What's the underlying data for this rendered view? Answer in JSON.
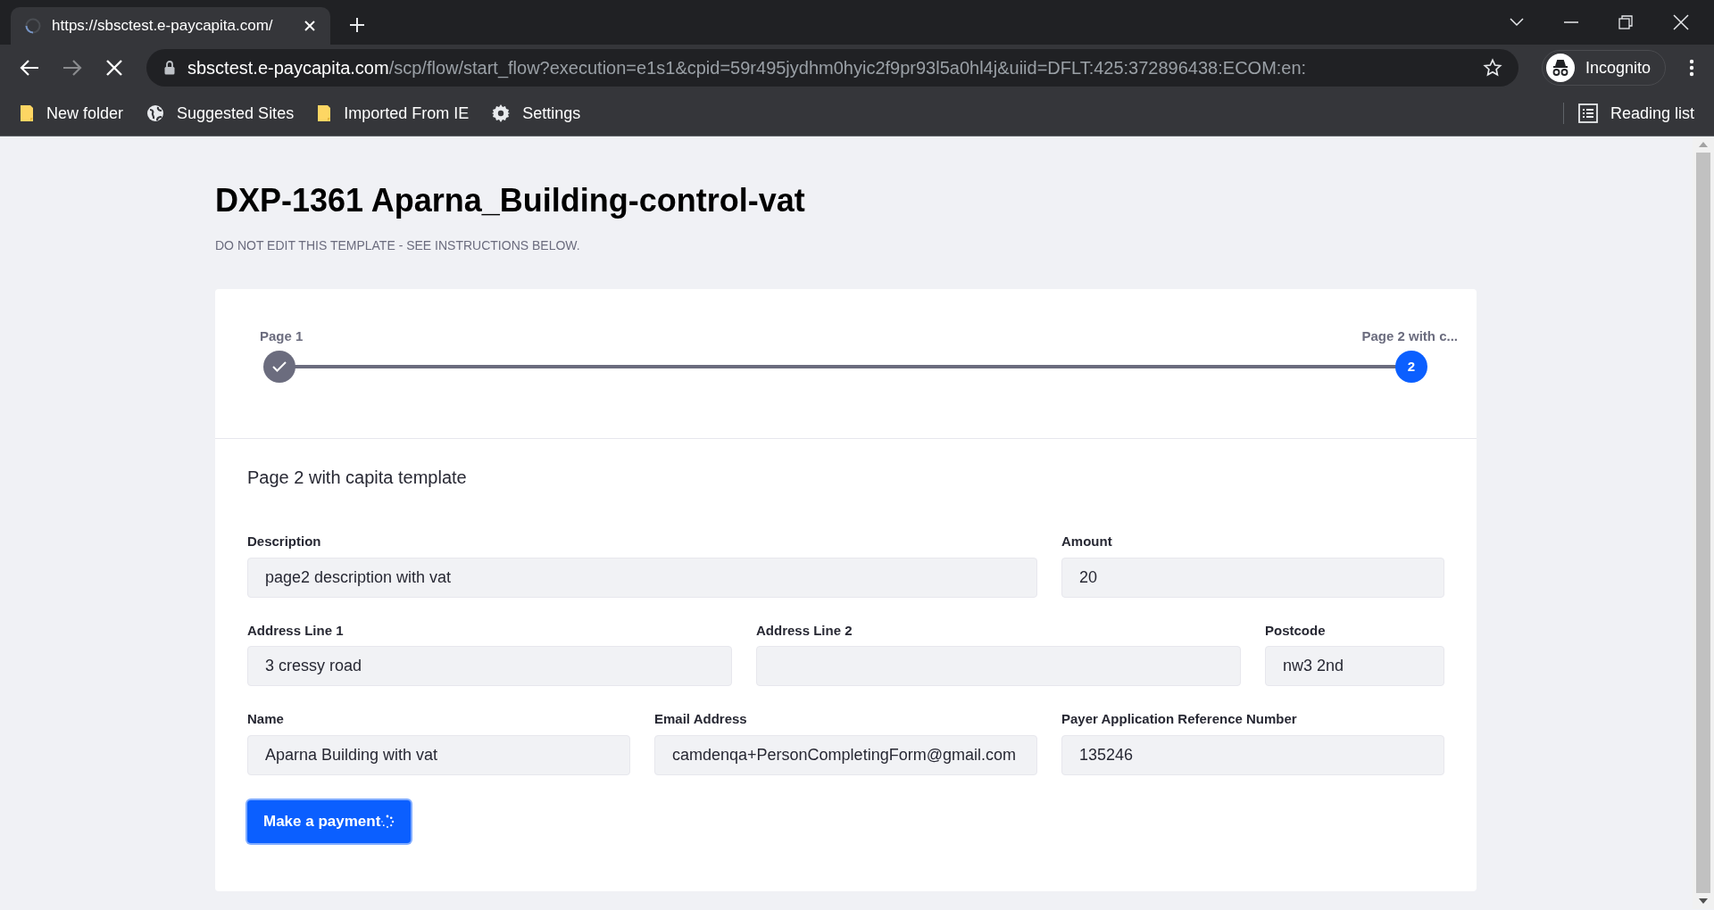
{
  "browser": {
    "tab": {
      "title": "https://sbsctest.e-paycapita.com/",
      "loading": true
    },
    "address": {
      "host": "sbsctest.e-paycapita.com",
      "path": "/scp/flow/start_flow?execution=e1s1&cpid=59r495jydhm0hyic2f9pr93l5a0hl4j&uiid=DFLT:425:372896438:ECOM:en:"
    },
    "profile": "Incognito",
    "bookmarks": [
      {
        "kind": "folder",
        "label": "New folder"
      },
      {
        "kind": "globe",
        "label": "Suggested Sites"
      },
      {
        "kind": "folder",
        "label": "Imported From IE"
      },
      {
        "kind": "gear",
        "label": "Settings"
      }
    ],
    "reading_list": "Reading list"
  },
  "page": {
    "title": "DXP-1361 Aparna_Building-control-vat",
    "subtitle": "DO NOT EDIT THIS TEMPLATE - SEE INSTRUCTIONS BELOW.",
    "steps": [
      {
        "label": "Page 1",
        "completed": true,
        "selected": false
      },
      {
        "label": "Page 2 with c...",
        "number": "2",
        "completed": false,
        "selected": true
      }
    ],
    "section_title": "Page 2 with capita template",
    "field_rows": [
      [
        {
          "label": "Description",
          "value": "page2 description with vat"
        },
        {
          "label": "Amount",
          "value": "20"
        }
      ],
      [
        {
          "label": "Address Line 1",
          "value": "3 cressy road"
        },
        {
          "label": "Address Line 2"
        },
        {
          "label": "Postcode",
          "value": "nw3 2nd"
        }
      ],
      [
        {
          "label": "Name",
          "value": "Aparna Building with vat"
        },
        {
          "label": "Email Address",
          "value": "camdenqa+PersonCompletingForm@gmail.com"
        },
        {
          "label": "Payer Application Reference Number",
          "value": "135246"
        }
      ]
    ],
    "submit": {
      "label": "Make a payment",
      "loading": true
    }
  }
}
